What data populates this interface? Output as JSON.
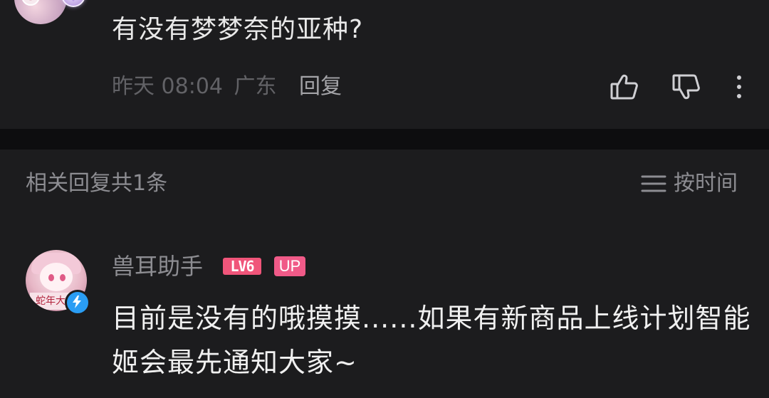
{
  "top_comment": {
    "text": "有没有梦梦奈的亚种?",
    "time": "昨天 08:04",
    "location": "广东",
    "reply_label": "回复"
  },
  "replies_section": {
    "title": "相关回复共1条",
    "sort_label": "按时间",
    "icons": [
      "menu-icon"
    ]
  },
  "reply": {
    "username": "兽耳助手",
    "level": "LV6",
    "up_tag": "UP",
    "avatar_banner": "蛇年大",
    "text": "目前是没有的哦摸摸......如果有新商品上线计划智能姬会最先通知大家~"
  },
  "colors": {
    "background": "#1c1c1e",
    "divider": "#0d0d0f",
    "muted_text": "#8d8d92",
    "level_badge": "#f0557a",
    "up_badge": "#f05a88",
    "verify_badge": "#2a9df4"
  },
  "action_icons": [
    "thumbs-up-icon",
    "thumbs-down-icon",
    "more-vertical-icon"
  ]
}
